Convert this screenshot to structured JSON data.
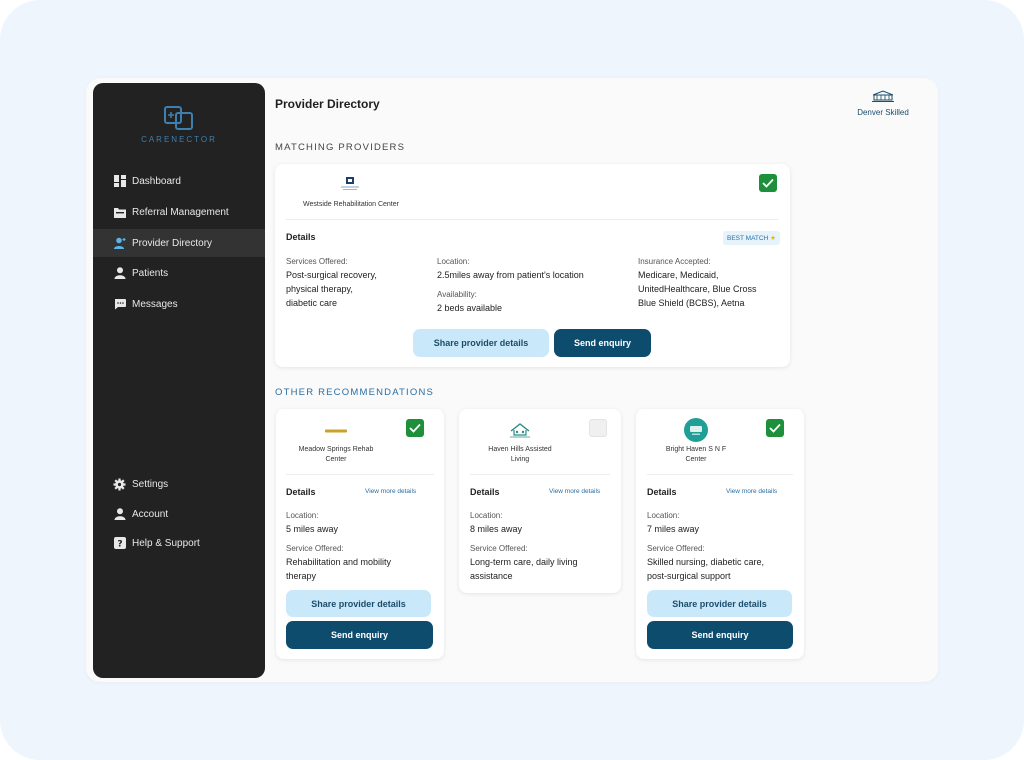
{
  "app": {
    "logo_text": "CARENECTOR"
  },
  "sidebar": {
    "nav": [
      {
        "label": "Dashboard",
        "icon": "dashboard-icon"
      },
      {
        "label": "Referral Management",
        "icon": "folder-icon"
      },
      {
        "label": "Provider Directory",
        "icon": "user-plus-icon"
      },
      {
        "label": "Patients",
        "icon": "person-icon"
      },
      {
        "label": "Messages",
        "icon": "chat-icon"
      }
    ],
    "bottom": [
      {
        "label": "Settings",
        "icon": "gear-icon"
      },
      {
        "label": "Account",
        "icon": "person-icon"
      },
      {
        "label": "Help & Support",
        "icon": "help-icon"
      }
    ]
  },
  "header": {
    "title": "Provider Directory",
    "user": "Denver Skilled"
  },
  "matching": {
    "section_label": "MATCHING PROVIDERS",
    "provider": "Westside Rehabilitation Center",
    "details_label": "Details",
    "badge": "BEST MATCH",
    "services_label": "Services Offered:",
    "services_lines": [
      "Post-surgical recovery,",
      "physical therapy,",
      "diabetic care"
    ],
    "location_label": "Location:",
    "location": "2.5miles away from patient's location",
    "availability_label": "Availability:",
    "availability": "2 beds available",
    "insurance_label": "Insurance Accepted:",
    "insurance_lines": [
      "Medicare, Medicaid,",
      "UnitedHealthcare, Blue Cross",
      "Blue Shield (BCBS), Aetna"
    ],
    "share_label": "Share provider details",
    "send_label": "Send enquiry"
  },
  "other": {
    "section_label": "OTHER RECOMMENDATIONS",
    "cards": [
      {
        "name_lines": [
          "Meadow Springs Rehab",
          "Center"
        ],
        "details_label": "Details",
        "more_label": "View more details",
        "location_label": "Location:",
        "location": "5 miles away",
        "service_label": "Service Offered:",
        "service_lines": [
          "Rehabilitation and mobility",
          "therapy"
        ],
        "share_label": "Share provider details",
        "send_label": "Send enquiry"
      },
      {
        "name_lines": [
          "Haven Hills Assisted",
          "Living"
        ],
        "details_label": "Details",
        "more_label": "View more details",
        "location_label": "Location:",
        "location": "8 miles away",
        "service_label": "Service Offered:",
        "service_lines": [
          "Long-term care, daily living",
          "assistance"
        ]
      },
      {
        "name_lines": [
          "Bright Haven S N F",
          "Center"
        ],
        "details_label": "Details",
        "more_label": "View more details",
        "location_label": "Location:",
        "location": "7 miles away",
        "service_label": "Service Offered:",
        "service_lines": [
          "Skilled nursing, diabetic care,",
          "post-surgical support"
        ],
        "share_label": "Share provider details",
        "send_label": "Send enquiry"
      }
    ]
  },
  "colors": {
    "accent_dark": "#0e4c6e",
    "accent_light": "#c9e8fa",
    "check_green": "#1e8f3b",
    "sidebar_bg": "#222222"
  }
}
